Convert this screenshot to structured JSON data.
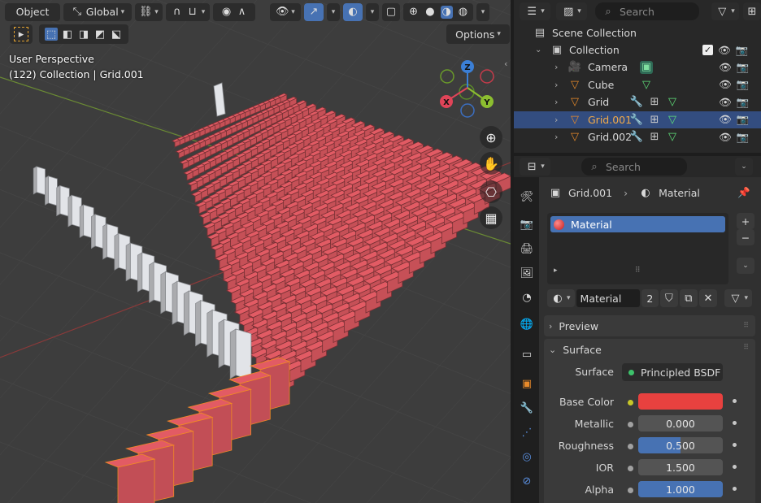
{
  "viewport": {
    "header": {
      "mode": "Object",
      "orientation": "Global"
    },
    "options_label": "Options",
    "view_name": "User Perspective",
    "info": "(122) Collection | Grid.001",
    "gizmo": {
      "x": "X",
      "y": "Y",
      "z": "Z"
    },
    "colors": {
      "background": "#3d3d3d",
      "dominoes_red": "#d7575f",
      "dominoes_white": "#e2e4e8",
      "selected_outline": "#f08a24"
    }
  },
  "outliner": {
    "search_placeholder": "Search",
    "items": [
      {
        "name": "Scene Collection",
        "icon": "scene-collection-icon"
      },
      {
        "name": "Collection",
        "icon": "collection-icon"
      },
      {
        "name": "Camera",
        "icon": "camera-object-icon"
      },
      {
        "name": "Cube",
        "icon": "mesh-object-icon"
      },
      {
        "name": "Grid",
        "icon": "mesh-object-icon"
      },
      {
        "name": "Grid.001",
        "icon": "mesh-object-icon",
        "selected": true
      },
      {
        "name": "Grid.002",
        "icon": "mesh-object-icon"
      }
    ]
  },
  "properties": {
    "search_placeholder": "Search",
    "breadcrumb": {
      "object": "Grid.001",
      "data": "Material"
    },
    "slots": [
      {
        "name": "Material"
      }
    ],
    "material_selector": {
      "name": "Material",
      "users": "2"
    },
    "panels": {
      "preview": "Preview",
      "surface": "Surface"
    },
    "surface": {
      "surface_label": "Surface",
      "surface_value": "Principled BSDF",
      "base_color_label": "Base Color",
      "base_color": "#e8413f",
      "metallic_label": "Metallic",
      "metallic": "0.000",
      "roughness_label": "Roughness",
      "roughness": "0.500",
      "roughness_fraction": 0.5,
      "ior_label": "IOR",
      "ior": "1.500",
      "alpha_label": "Alpha",
      "alpha": "1.000",
      "alpha_fraction": 1.0
    }
  }
}
